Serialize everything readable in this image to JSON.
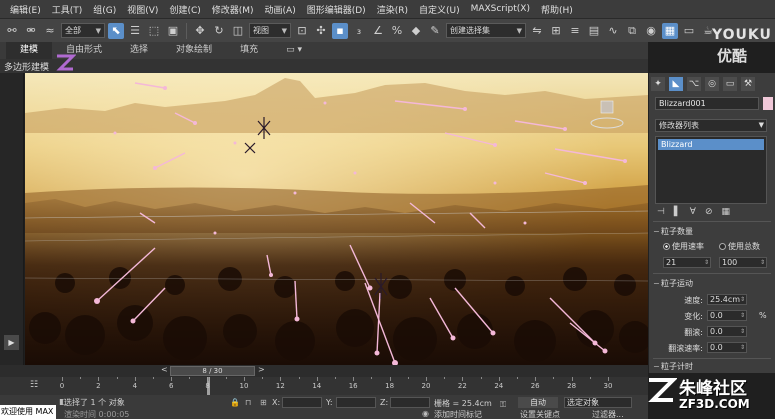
{
  "menu": {
    "items": [
      "编辑(E)",
      "工具(T)",
      "组(G)",
      "视图(V)",
      "创建(C)",
      "修改器(M)",
      "动画(A)",
      "图形编辑器(D)",
      "渲染(R)",
      "自定义(U)",
      "MAXScript(X)",
      "帮助(H)"
    ]
  },
  "toolbar": {
    "selection_filter": "全部",
    "coord_system": "视图",
    "named_selection": "创建选择集"
  },
  "ribbon": {
    "tabs": [
      "建模",
      "自由形式",
      "选择",
      "对象绘制",
      "填充"
    ],
    "subtitle": "多边形建模"
  },
  "command_panel": {
    "object_name": "Blizzard001",
    "object_color": "#f0c8d8",
    "modifier_list": "修改器列表",
    "stack_item": "Blizzard",
    "rollout_quantity": "粒子数量",
    "radio_rate": "使用速率",
    "radio_total": "使用总数",
    "rate_value": "21",
    "total_value": "100",
    "rollout_motion": "粒子运动",
    "speed_label": "速度:",
    "speed_value": "25.4cm",
    "variation_label": "变化:",
    "variation_value": "0.0",
    "variation_unit": "%",
    "tumble_label": "翻滚:",
    "tumble_value": "0.0",
    "tumble_rate_label": "翻滚速率:",
    "tumble_rate_value": "0.0",
    "rollout_timing": "粒子计时"
  },
  "timeline": {
    "frame_display": "8 / 30",
    "current_frame": 8,
    "total_frames": 30,
    "ticks": [
      0,
      2,
      4,
      6,
      8,
      10,
      12,
      14,
      16,
      18,
      20,
      22,
      24,
      26,
      28,
      30
    ]
  },
  "status": {
    "maxscript_label": "欢迎使用 MAX",
    "selection_info": "选择了 1 个 对象",
    "render_time": "渲染时间 0:00:05",
    "x_label": "X:",
    "y_label": "Y:",
    "z_label": "Z:",
    "grid_info": "栅格 = 25.4cm",
    "add_time_tag": "添加时间标记",
    "auto_key": "自动",
    "selected_object": "选定对象",
    "set_key": "设置关键点",
    "key_filters": "过滤器..."
  },
  "watermarks": {
    "youku_line1": "YOUKU",
    "youku_line2": "优酷",
    "zf_line1": "朱峰社区",
    "zf_line2": "ZF3D.COM"
  }
}
